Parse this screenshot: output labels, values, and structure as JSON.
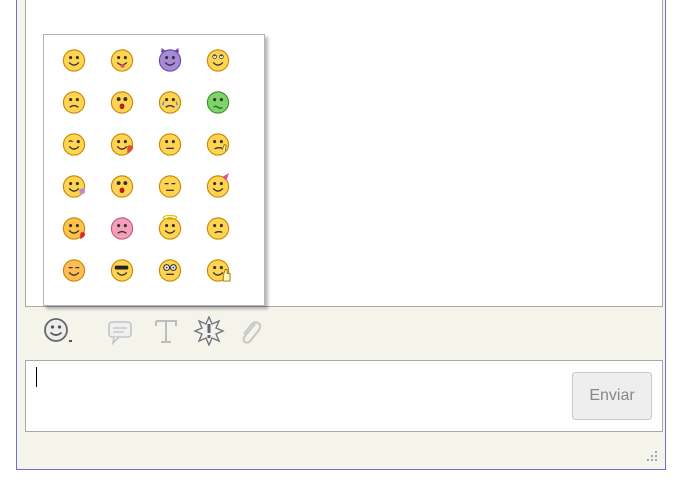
{
  "composer": {
    "send_label": "Enviar",
    "message_value": ""
  },
  "toolbar": {
    "items": [
      "emoticon-menu-icon",
      "nudge-icon",
      "font-icon",
      "wink-icon",
      "attach-icon"
    ]
  },
  "emoticons": [
    "smile",
    "tongue",
    "devil",
    "eyeroll",
    "sad",
    "surprised",
    "crying",
    "sick",
    "wink",
    "embarrassed",
    "neutral",
    "thinking",
    "drunk",
    "shocked",
    "sleepy",
    "party",
    "in-love",
    "angry",
    "angel",
    "confused",
    "blush",
    "cool",
    "nerd",
    "thumbs-up"
  ],
  "colors": {
    "window_border": "#6f6fd0",
    "face": "#ffd452",
    "face_outline": "#c88a00"
  }
}
